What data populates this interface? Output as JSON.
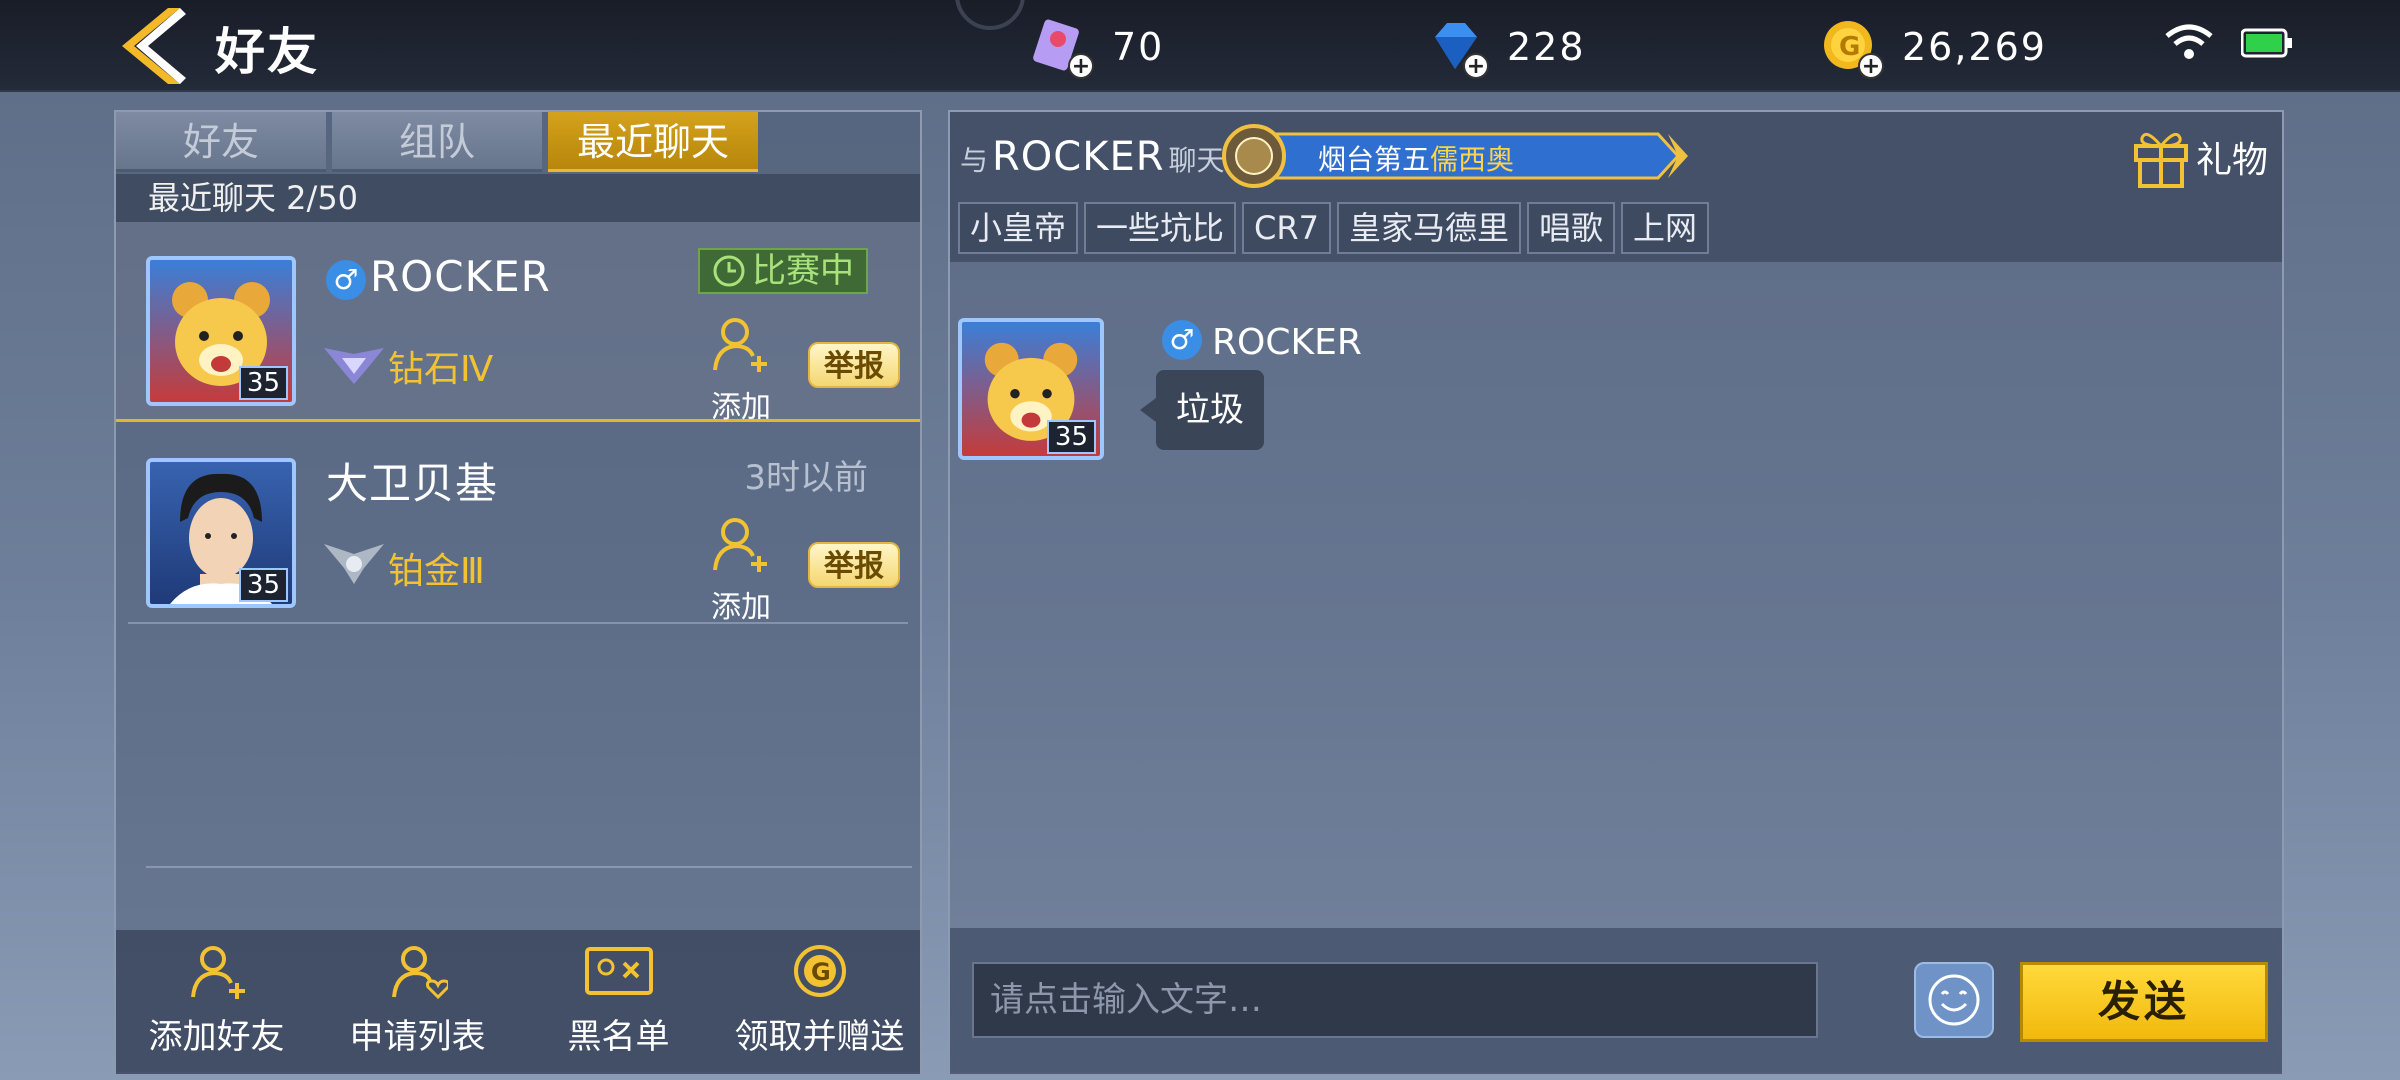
{
  "header": {
    "title": "好友",
    "resources": [
      {
        "name": "tickets",
        "icon": "ticket-icon",
        "value": "70"
      },
      {
        "name": "diamonds",
        "icon": "diamond-icon",
        "value": "228"
      },
      {
        "name": "coins",
        "icon": "gold-coin-icon",
        "value": "26,269"
      }
    ],
    "status": {
      "wifi_icon": "wifi-icon",
      "battery_icon": "battery-icon",
      "battery_color": "#2fd14a"
    }
  },
  "tabs": [
    {
      "label": "好友",
      "active": false
    },
    {
      "label": "组队",
      "active": false
    },
    {
      "label": "最近聊天",
      "active": true
    }
  ],
  "recent_count": "最近聊天 2/50",
  "friends": [
    {
      "name": "ROCKER",
      "gender": "♂",
      "level": "35",
      "rank": "钻石Ⅳ",
      "status": "比赛中",
      "add_label": "添加",
      "report_label": "举报"
    },
    {
      "name": "大卫贝基",
      "gender": "",
      "level": "35",
      "rank": "铂金Ⅲ",
      "status": "3时以前",
      "add_label": "添加",
      "report_label": "举报"
    }
  ],
  "bottom_actions": [
    {
      "label": "添加好友",
      "icon": "add-friend-icon"
    },
    {
      "label": "申请列表",
      "icon": "request-list-icon"
    },
    {
      "label": "黑名单",
      "icon": "blacklist-icon"
    },
    {
      "label": "领取并赠送",
      "icon": "gift-coin-icon"
    }
  ],
  "chat": {
    "prefix": "与",
    "partner": "ROCKER",
    "suffix": "聊天",
    "team_plain": "烟台第五",
    "team_highlight": "儒西奥",
    "gift_label": "礼物",
    "tags": [
      "小皇帝",
      "一些坑比",
      "CR7",
      "皇家马德里",
      "唱歌",
      "上网"
    ],
    "messages": [
      {
        "sender": "ROCKER",
        "gender": "♂",
        "level": "35",
        "text": "垃圾"
      }
    ],
    "input_placeholder": "请点击输入文字…",
    "send_label": "发送"
  },
  "colors": {
    "accent_gold": "#d4a21b",
    "send_yellow": "#ffd93b",
    "status_green": "#a9e27a",
    "rank_gold": "#f2c232"
  }
}
